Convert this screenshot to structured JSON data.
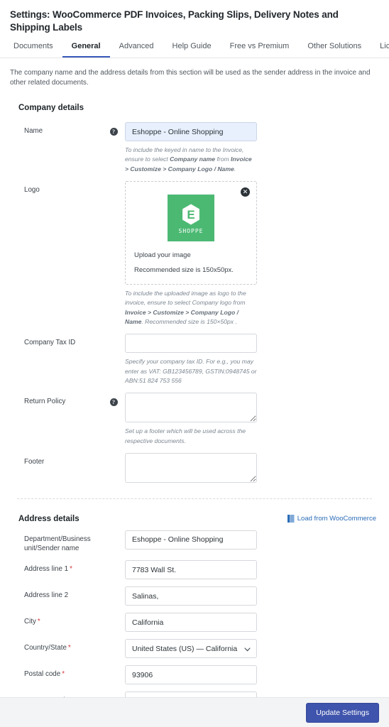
{
  "header": {
    "title": "Settings: WooCommerce PDF Invoices, Packing Slips, Delivery Notes and Shipping Labels",
    "intro": "The company name and the address details from this section will be used as the sender address in the invoice and other related documents."
  },
  "tabs": [
    {
      "label": "Documents",
      "active": false
    },
    {
      "label": "General",
      "active": true
    },
    {
      "label": "Advanced",
      "active": false
    },
    {
      "label": "Help Guide",
      "active": false
    },
    {
      "label": "Free vs Premium",
      "active": false
    },
    {
      "label": "Other Solutions",
      "active": false
    },
    {
      "label": "Licence",
      "active": false
    }
  ],
  "company_section": {
    "title": "Company details",
    "name": {
      "label": "Name",
      "value": "Eshoppe - Online Shopping",
      "placeholder": "",
      "help_icon": "question-mark-icon",
      "hint_plain_1": "To include the keyed in name to the Invoice, ensure to select ",
      "hint_bold_1": "Company name",
      "hint_plain_2": " from ",
      "hint_bold_2": "Invoice > Customize > Company Logo / Name",
      "hint_plain_3": "."
    },
    "logo": {
      "label": "Logo",
      "close_icon": "close-icon",
      "logo_letter": "E",
      "logo_word": "SHOPPE",
      "logo_color": "#4cb973",
      "upload_text": "Upload your image",
      "recommended_text": "Recommended size is 150x50px.",
      "hint_plain_1": "To include the uploaded image as logo to the invoice, ensure to select Company logo from ",
      "hint_bold_1": "Invoice > Customize > Company Logo / Name",
      "hint_plain_2": ". Recommended size is 150×50px ."
    },
    "tax_id": {
      "label": "Company Tax ID",
      "value": "",
      "placeholder": "",
      "hint": "Specify your company tax ID. For e.g., you may enter as VAT: GB123456789, GSTIN:0948745 or ABN:51 824 753 556"
    },
    "return_policy": {
      "label": "Return Policy",
      "value": "",
      "placeholder": "",
      "help_icon": "question-mark-icon",
      "hint": "Set up a footer which will be used across the respective documents."
    },
    "footer_field": {
      "label": "Footer",
      "value": "",
      "placeholder": ""
    }
  },
  "address_section": {
    "title": "Address details",
    "load_link": {
      "label": "Load from WooCommerce",
      "icon": "import-book-icon",
      "color": "#2b6cb7"
    },
    "fields": [
      {
        "label": "Department/Business unit/Sender name",
        "value": "Eshoppe - Online Shopping",
        "placeholder": "",
        "required": false,
        "type": "text"
      },
      {
        "label": "Address line 1",
        "value": "7783 Wall St.",
        "placeholder": "",
        "required": true,
        "type": "text"
      },
      {
        "label": "Address line 2",
        "value": "Salinas,",
        "placeholder": "",
        "required": false,
        "type": "text"
      },
      {
        "label": "City",
        "value": "California",
        "placeholder": "",
        "required": true,
        "type": "text"
      },
      {
        "label": "Country/State",
        "value": "United States (US) — California",
        "placeholder": "",
        "required": true,
        "type": "select"
      },
      {
        "label": "Postal code",
        "value": "93906",
        "placeholder": "",
        "required": true,
        "type": "text"
      },
      {
        "label": "Contact number",
        "value": "",
        "placeholder": "",
        "required": false,
        "type": "text"
      }
    ]
  },
  "footer": {
    "update_button": "Update Settings",
    "button_color": "#3f54ac"
  }
}
